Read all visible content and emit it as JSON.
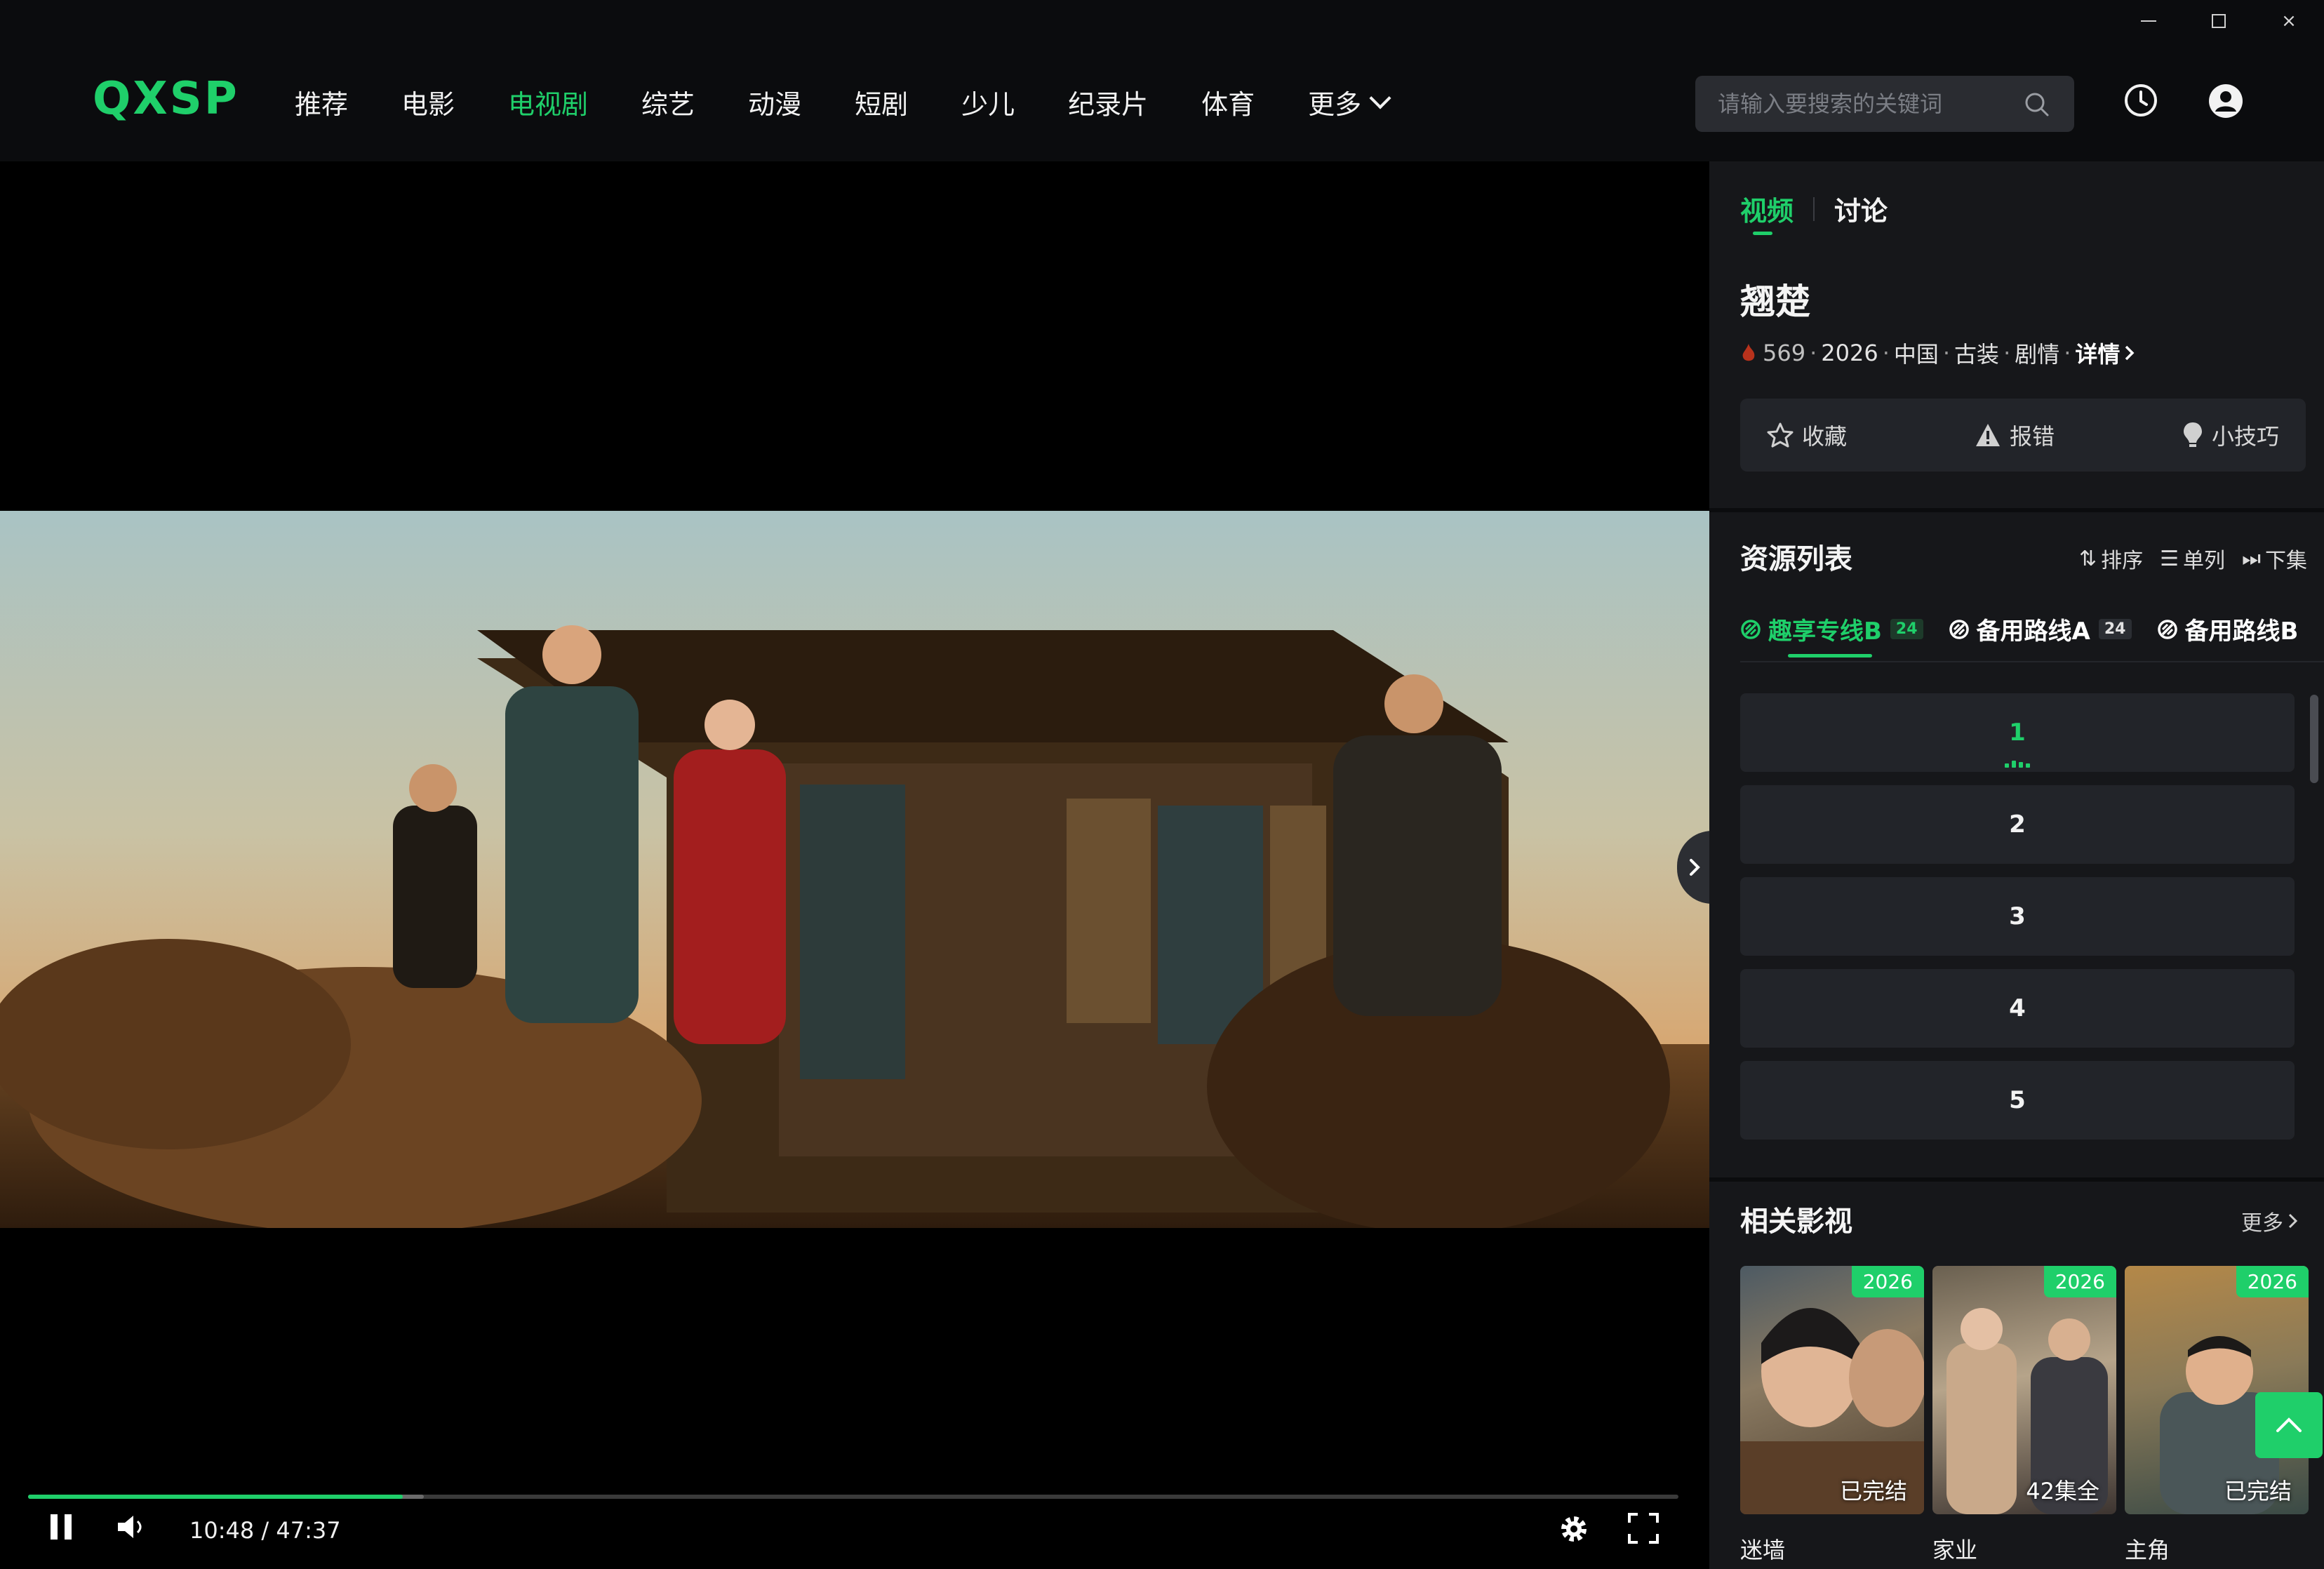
{
  "window": {
    "minimize": "–",
    "maximize": "",
    "close": "×"
  },
  "header": {
    "logo": "QXSP",
    "nav": [
      "推荐",
      "电影",
      "电视剧",
      "综艺",
      "动漫",
      "短剧",
      "少儿",
      "纪录片",
      "体育",
      "更多"
    ],
    "active_nav": "电视剧",
    "search_placeholder": "请输入要搜索的关键词"
  },
  "player": {
    "current_time": "10:48",
    "duration": "47:37",
    "time_display": "10:48 / 47:37",
    "progress_played": 0.227,
    "progress_buffered": 0.24
  },
  "side": {
    "tabs": [
      "视频",
      "讨论"
    ],
    "active_tab": "视频",
    "title": "翘楚",
    "meta": {
      "heat": "569",
      "year": "2026",
      "region": "中国",
      "genre1": "古装",
      "genre2": "剧情",
      "detail": "详情"
    },
    "actions": {
      "favorite": "收藏",
      "report": "报错",
      "tips": "小技巧"
    },
    "resources": {
      "title": "资源列表",
      "tools": {
        "sort": "排序",
        "single": "单列",
        "next": "下集"
      },
      "sources": [
        {
          "name": "趣享专线B",
          "count": "24"
        },
        {
          "name": "备用路线A",
          "count": "24"
        },
        {
          "name": "备用路线B",
          "count": ""
        }
      ],
      "episodes": [
        "1",
        "2",
        "3",
        "4",
        "5"
      ],
      "current_episode": "1"
    },
    "related": {
      "title": "相关影视",
      "more": "更多",
      "items": [
        {
          "name": "迷墙",
          "year": "2026",
          "status": "已完结"
        },
        {
          "name": "家业",
          "year": "2026",
          "status": "42集全"
        },
        {
          "name": "主角",
          "year": "2026",
          "status": "已完结"
        }
      ]
    }
  },
  "colors": {
    "accent": "#1fcf6a",
    "bg": "#0b0c0e",
    "panel": "#16171a",
    "card": "#222429"
  }
}
